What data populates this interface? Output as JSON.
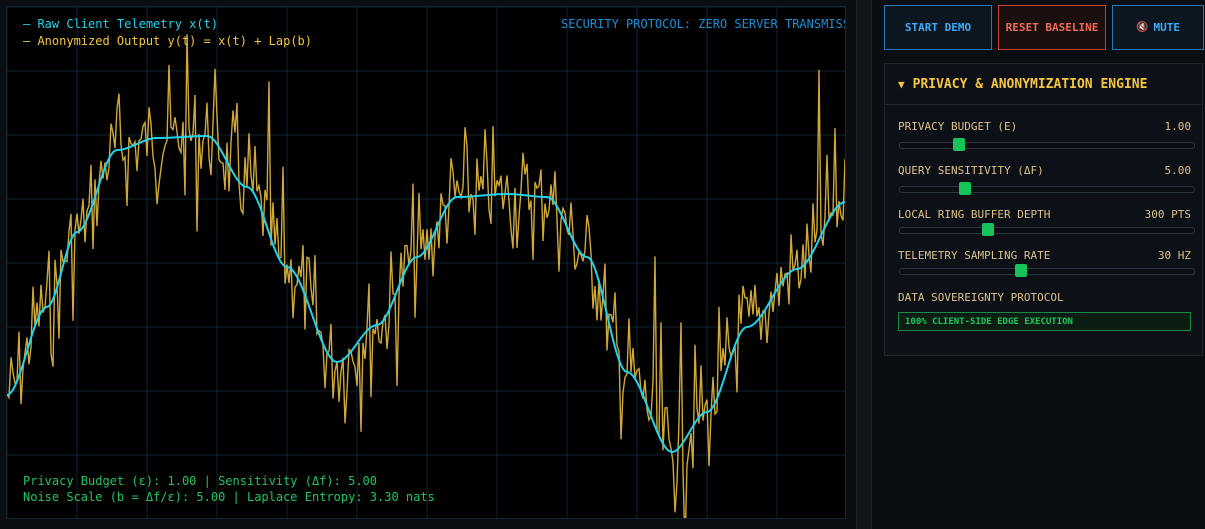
{
  "scope": {
    "legend_raw": "— Raw Client Telemetry x(t)",
    "legend_anon": "— Anonymized Output y(t) = x(t) + Lap(b)",
    "protocol_banner": "SECURITY PROTOCOL: ZERO SERVER TRANSMISSION",
    "stats_line1": "Privacy Budget (ε): 1.00 | Sensitivity (Δf): 5.00",
    "stats_line2": "Noise Scale (b = Δf/ε): 5.00 | Laplace Entropy: 3.30 nats",
    "colors": {
      "raw": "#22d3ee",
      "anon": "#f4c542",
      "grid": "#0f2230"
    }
  },
  "toolbar": {
    "start_label": "START DEMO",
    "reset_label": "RESET BASELINE",
    "mute_icon": "speaker-muted-icon",
    "mute_glyph": "🔇",
    "mute_label": "MUTE"
  },
  "engine": {
    "title": "PRIVACY & ANONYMIZATION ENGINE",
    "caret": "▼",
    "controls": [
      {
        "label": "PRIVACY BUDGET (E)",
        "value": "1.00",
        "fraction": 0.2
      },
      {
        "label": "QUERY SENSITIVITY (ΔF)",
        "value": "5.00",
        "fraction": 0.22
      },
      {
        "label": "LOCAL RING BUFFER DEPTH",
        "value": "300 PTS",
        "fraction": 0.3
      },
      {
        "label": "TELEMETRY SAMPLING RATE",
        "value": "30 HZ",
        "fraction": 0.41
      }
    ],
    "sovereignty_label": "DATA SOVEREIGNTY PROTOCOL",
    "sovereignty_badge": "100% CLIENT-SIDE EDGE EXECUTION"
  }
}
